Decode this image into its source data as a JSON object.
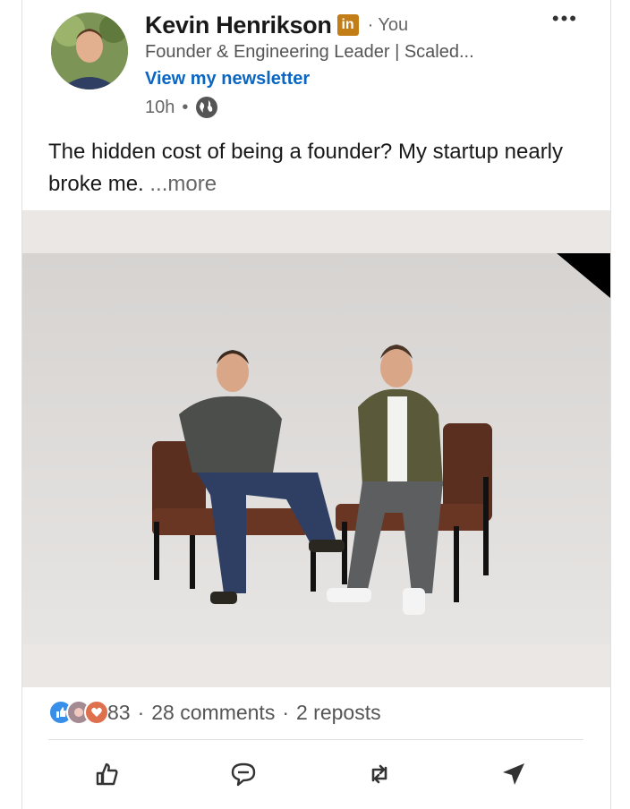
{
  "post": {
    "author_name": "Kevin Henrikson",
    "badge_text": "in",
    "you_label": "· You",
    "menu_label": "•••",
    "headline": "Founder & Engineering Leader | Scaled...",
    "newsletter_link": "View my newsletter",
    "time_ago": "10h",
    "time_sep": "•",
    "text_line": "The hidden cost of being a founder? My startup nearly broke me.",
    "more_link": "...more"
  },
  "stats": {
    "reactions_count": "83",
    "comments": "28 comments",
    "reposts": "2 reposts",
    "sep": "·"
  },
  "icons": {
    "like": "thumbs-up-icon",
    "comment": "comment-icon",
    "repost": "repost-icon",
    "send": "send-icon",
    "globe": "globe-icon"
  },
  "colors": {
    "link": "#0a66c2",
    "badge": "#c37d16",
    "like_reaction": "#378fe9",
    "love_reaction": "#df704d"
  }
}
